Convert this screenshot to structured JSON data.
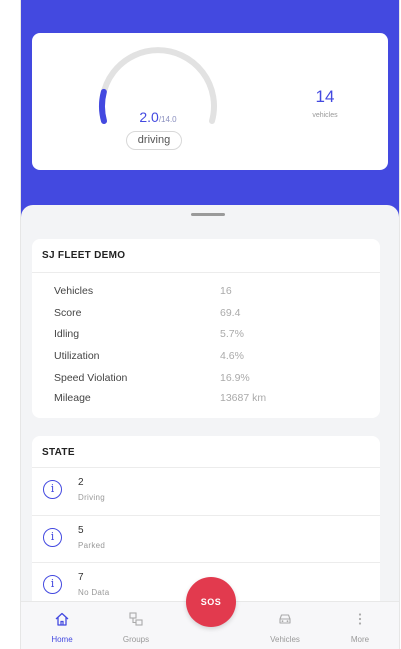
{
  "summary": {
    "gauge": {
      "value": "2.0",
      "max": "/14.0",
      "status": "driving",
      "fraction": 0.143
    },
    "vehicles": {
      "count": "14",
      "label": "vehicles"
    }
  },
  "fleet": {
    "title": "SJ FLEET DEMO",
    "stats": [
      {
        "label": "Vehicles",
        "value": "16"
      },
      {
        "label": "Score",
        "value": "69.4"
      },
      {
        "label": "Idling",
        "value": "5.7%"
      },
      {
        "label": "Utilization",
        "value": "4.6%"
      },
      {
        "label": "Speed Violation",
        "value": "16.9%"
      },
      {
        "label": "Mileage",
        "value": "13687 km"
      }
    ]
  },
  "state": {
    "title": "STATE",
    "items": [
      {
        "count": "2",
        "label": "Driving"
      },
      {
        "count": "5",
        "label": "Parked"
      },
      {
        "count": "7",
        "label": "No Data"
      }
    ]
  },
  "sos": {
    "label": "SOS"
  },
  "tabs": [
    {
      "label": "Home",
      "icon": "home-icon",
      "active": true
    },
    {
      "label": "Groups",
      "icon": "groups-icon",
      "active": false
    },
    {
      "label": "Vehicles",
      "icon": "car-icon",
      "active": false
    },
    {
      "label": "More",
      "icon": "more-icon",
      "active": false
    }
  ],
  "colors": {
    "accent": "#4349e0",
    "sos": "#e23a4e",
    "background": "#f3f4f6"
  }
}
